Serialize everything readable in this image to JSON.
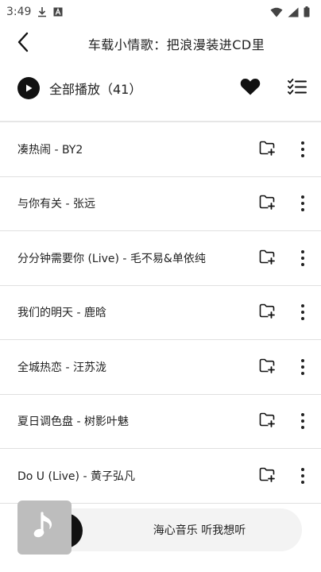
{
  "status_bar": {
    "time": "3:49",
    "icons": [
      "download-icon",
      "a-icon",
      "wifi-icon",
      "signal-icon",
      "battery-icon"
    ]
  },
  "header": {
    "title": "车载小情歌：把浪漫装进CD里",
    "back_icon": "chevron-left-icon"
  },
  "play_row": {
    "label": "全部播放（41）",
    "icons": [
      "play-icon",
      "heart-icon",
      "checklist-icon"
    ]
  },
  "songs": [
    {
      "title": "凑热闹 - BY2"
    },
    {
      "title": "与你有关 - 张远"
    },
    {
      "title": "分分钟需要你 (Live) - 毛不易&单依纯"
    },
    {
      "title": "我们的明天 - 鹿晗"
    },
    {
      "title": "全城热恋 - 汪苏泷"
    },
    {
      "title": "夏日调色盘 - 树影叶魅"
    },
    {
      "title": "Do U (Live) - 黄子弘凡"
    }
  ],
  "song_row_icons": [
    "add-to-playlist-icon",
    "more-vertical-icon"
  ],
  "mini_player": {
    "text": "海心音乐 听我想听",
    "cover_icon": "music-note-icon"
  },
  "colors": {
    "background": "#ffffff",
    "divider": "#e0e0e0",
    "icon": "#111111",
    "mini_bar": "#f3f3f3",
    "cover": "#bdbdbd"
  }
}
